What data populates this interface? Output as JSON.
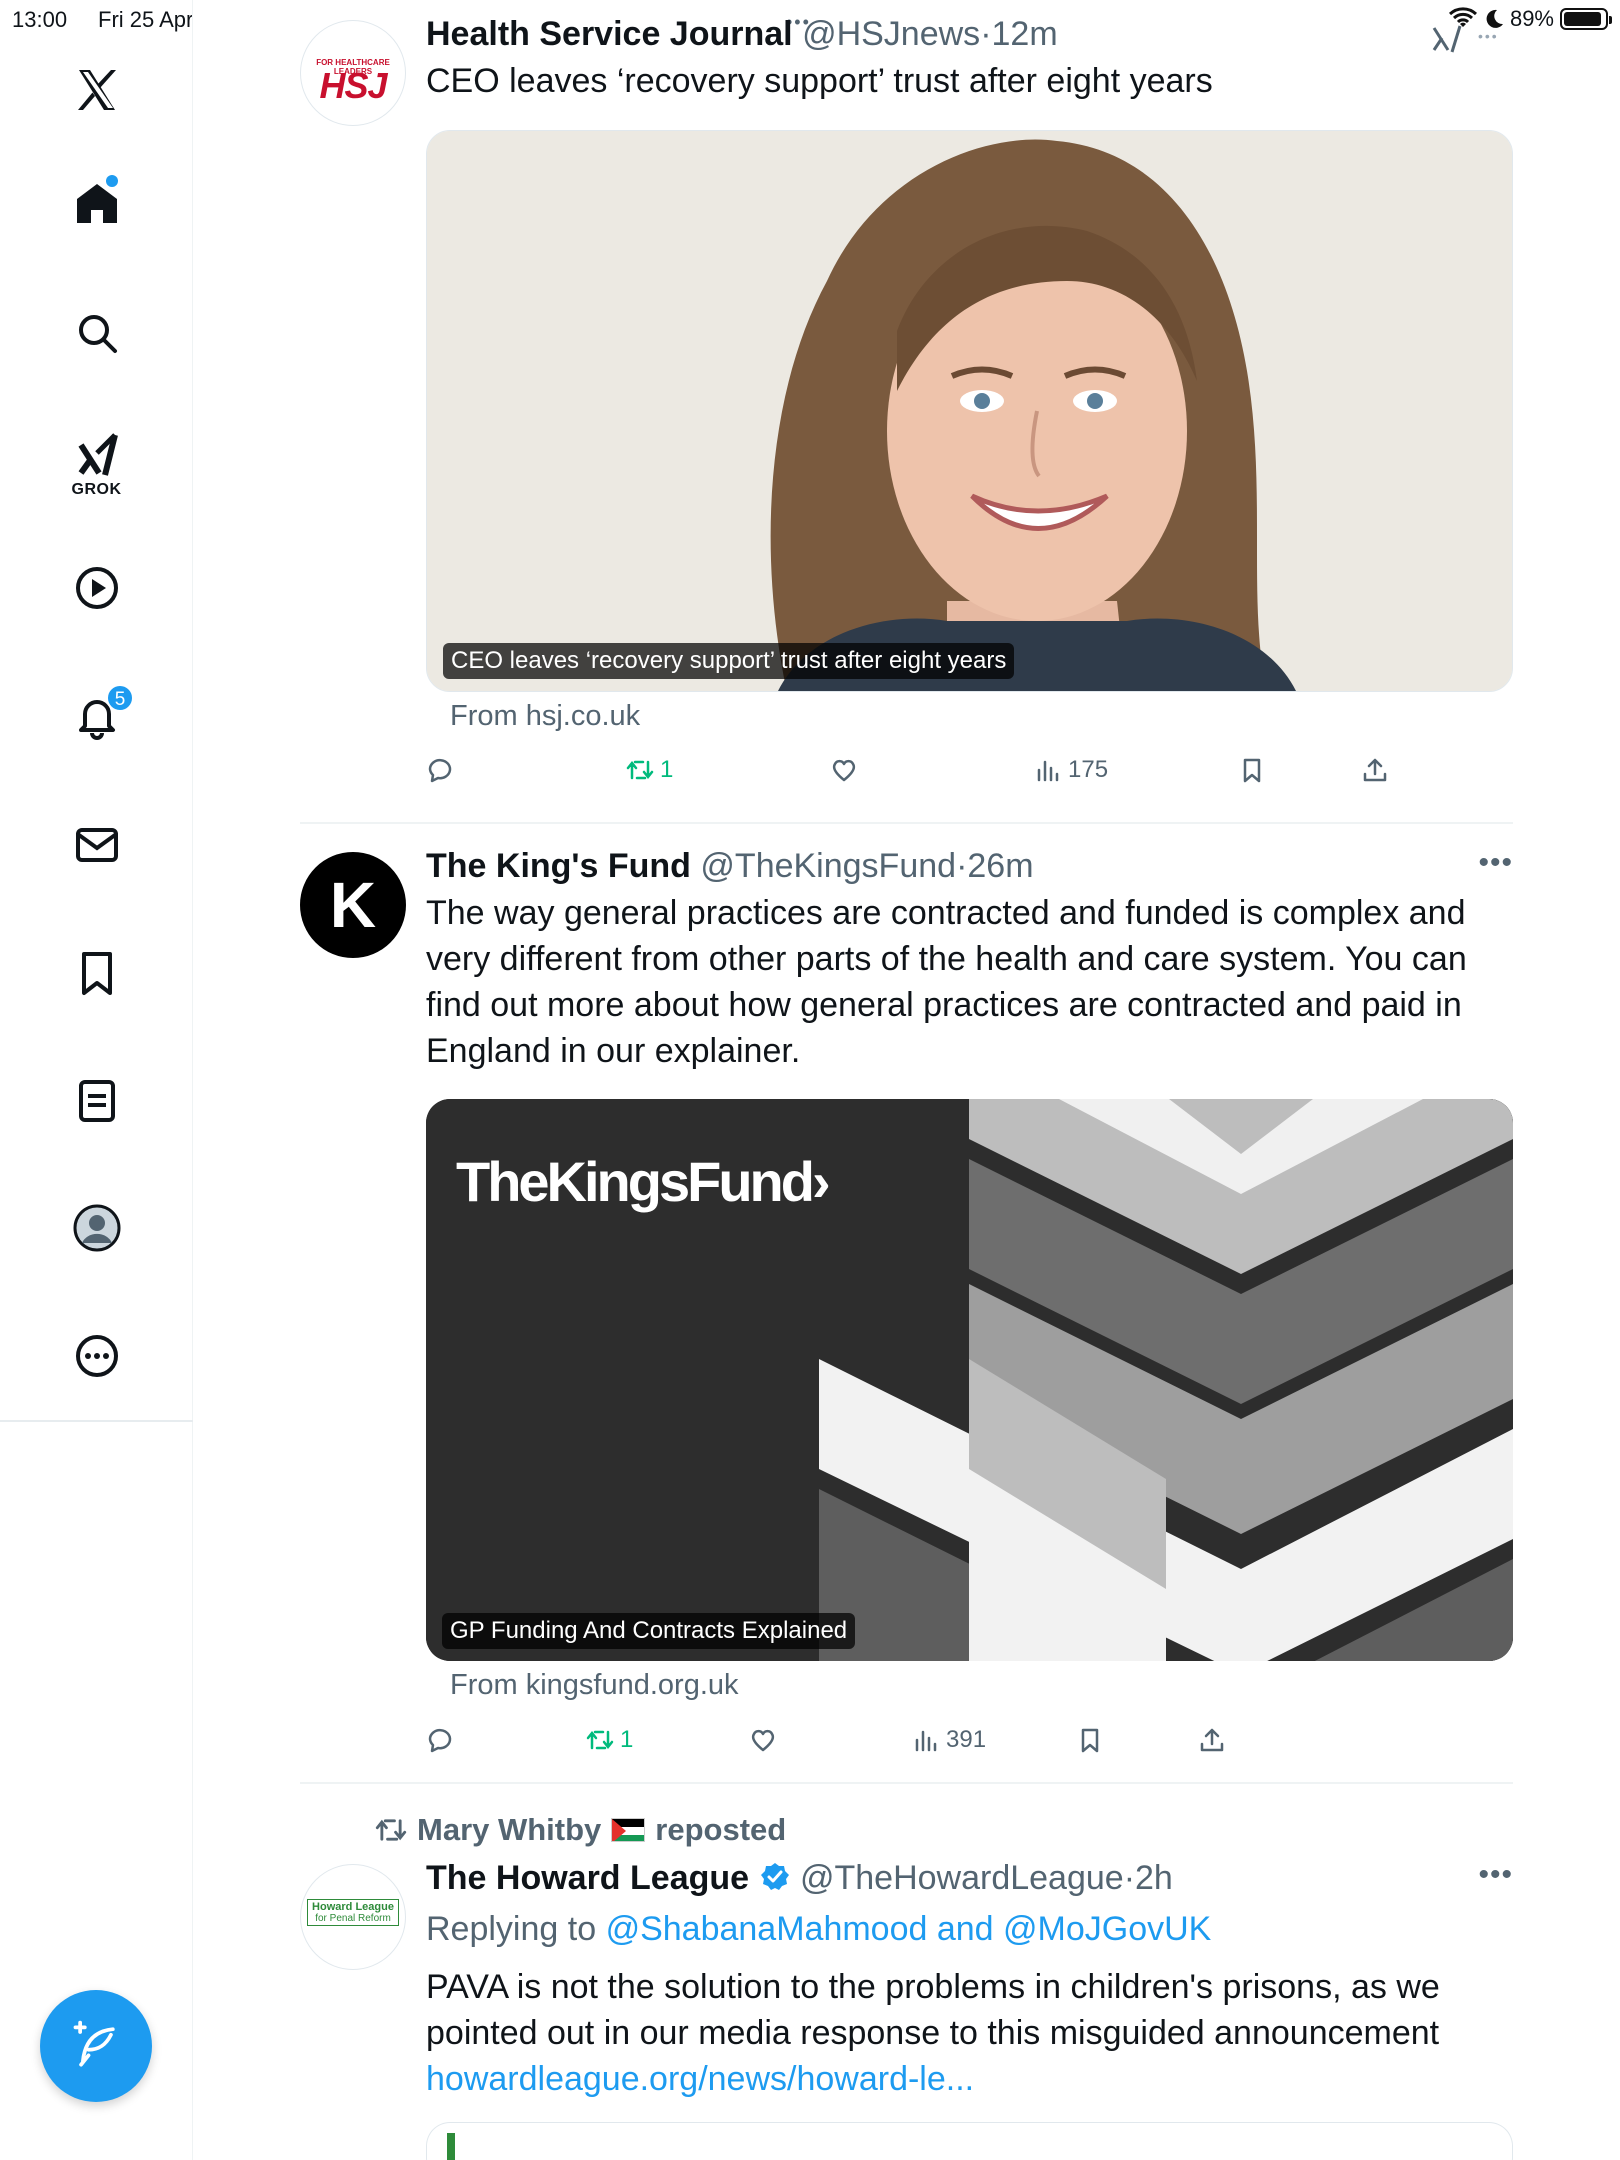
{
  "status_bar": {
    "time": "13:00",
    "date": "Fri 25 Apr",
    "battery": "89%"
  },
  "sidebar": {
    "grok_label": "GROK",
    "notifications_count": "5"
  },
  "tweets": [
    {
      "name": "Health Service Journal",
      "handle": "@HSJnews",
      "time": "12m",
      "avatar_text": "HSJ",
      "avatar_subtext": "FOR HEALTHCARE LEADERS",
      "text": "CEO leaves ‘recovery support’ trust after eight years",
      "card_caption": "CEO leaves ‘recovery support’ trust after eight years",
      "from": "From hsj.co.uk",
      "retweets": "1",
      "views": "175"
    },
    {
      "name": "The King's Fund",
      "handle": "@TheKingsFund",
      "time": "26m",
      "avatar_text": "K",
      "text": "The way general practices are contracted and funded is complex and very different from other parts of the health and care system. You can find out more about how general practices are contracted and paid in England in our explainer.",
      "card_brand": "TheKingsFund›",
      "card_caption": "GP Funding And Contracts Explained",
      "from": "From kingsfund.org.uk",
      "retweets": "1",
      "views": "391"
    },
    {
      "reposted_by": "Mary Whitby",
      "reposted_suffix": "reposted",
      "name": "The Howard League",
      "handle": "@TheHowardLeague",
      "time": "2h",
      "avatar_text_1": "Howard League",
      "avatar_text_2": "for Penal Reform",
      "replying_prefix": "Replying to",
      "replying_to": "@ShabanaMahmood and @MoJGovUK",
      "text": "PAVA is not the solution to the problems in children's prisons, as we pointed out in our media response to this misguided announcement",
      "link": "howardleague.org/news/howard-le..."
    }
  ]
}
